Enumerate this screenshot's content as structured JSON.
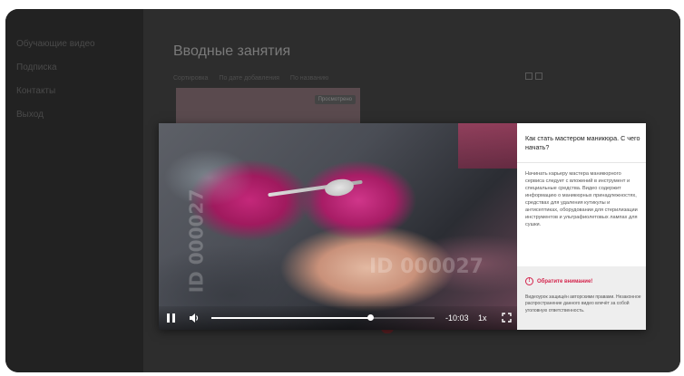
{
  "sidebar": {
    "items": [
      {
        "label": "Обучающие видео"
      },
      {
        "label": "Подписка"
      },
      {
        "label": "Контакты"
      },
      {
        "label": "Выход"
      }
    ]
  },
  "main": {
    "title": "Вводные занятия",
    "filters": [
      "Сортировка",
      "По дате добавления",
      "По названию"
    ],
    "card_badge": "Просмотрено"
  },
  "video": {
    "watermark": "ID 000027",
    "time_remaining": "-10:03",
    "speed": "1x",
    "progress_fraction": 0.71
  },
  "info": {
    "title": "Как стать мастером маникюра. С чего начать?",
    "description": "Начинать карьеру мастера маникюрного сервиса следует с вложений в инструмент и специальные средства. Видео содержит информацию о маникюрных принадлежностях, средствах для удаления кутикулы и антисептиках, оборудовании для стерилизации инструментов и ультрафиолетовых лампах для сушки.",
    "notice_title": "Обратите внимание!",
    "notice_text": "Видеоурок защищён авторскими правами. Незаконное распространение данного видео влечёт за собой уголовную ответственность."
  },
  "colors": {
    "accent": "#d4234b",
    "overlay": "#2b2b2b"
  }
}
